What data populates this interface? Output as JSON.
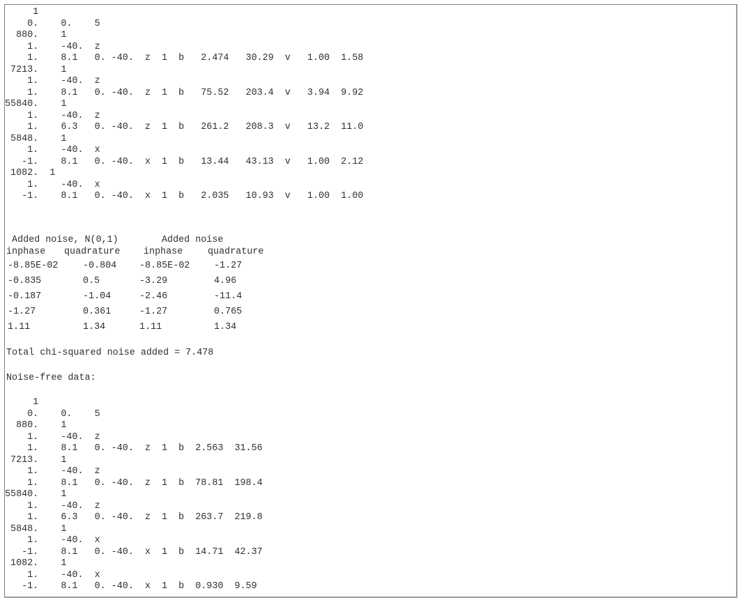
{
  "top_rows": [
    "     1",
    "    0.    0.    5",
    "  880.    1",
    "    1.    -40.  z",
    "    1.    8.1   0. -40.  z  1  b   2.474   30.29  v   1.00  1.58",
    " 7213.    1",
    "    1.    -40.  z",
    "    1.    8.1   0. -40.  z  1  b   75.52   203.4  v   3.94  9.92",
    "55840.    1",
    "    1.    -40.  z",
    "    1.    6.3   0. -40.  z  1  b   261.2   208.3  v   13.2  11.0",
    " 5848.    1",
    "    1.    -40.  x",
    "   -1.    8.1   0. -40.  x  1  b   13.44   43.13  v   1.00  2.12",
    " 1082.  1",
    "    1.    -40.  x",
    "   -1.    8.1   0. -40.  x  1  b   2.035   10.93  v   1.00  1.00"
  ],
  "noise_table": {
    "title_left": " Added noise, N(0,1)",
    "title_right": "Added noise",
    "headers": [
      "inphase",
      "quadrature",
      "inphase",
      "quadrature"
    ],
    "rows": [
      [
        "-8.85E-02",
        "-0.804",
        "-8.85E-02",
        "-1.27"
      ],
      [
        "-0.835",
        "0.5",
        "-3.29",
        "4.96"
      ],
      [
        "-0.187",
        "-1.04",
        "-2.46",
        "-11.4"
      ],
      [
        "-1.27",
        "0.361",
        "-1.27",
        "0.765"
      ],
      [
        "1.11",
        "1.34",
        "1.11",
        "1.34"
      ]
    ]
  },
  "chi_squared_line": "Total chi-squared noise added = 7.478",
  "noise_free_label": "Noise-free data:",
  "bottom_rows": [
    "     1",
    "    0.    0.    5",
    "  880.    1",
    "    1.    -40.  z",
    "    1.    8.1   0. -40.  z  1  b  2.563  31.56",
    " 7213.    1",
    "    1.    -40.  z",
    "    1.    8.1   0. -40.  z  1  b  78.81  198.4",
    "55840.    1",
    "    1.    -40.  z",
    "    1.    6.3   0. -40.  z  1  b  263.7  219.8",
    " 5848.    1",
    "    1.    -40.  x",
    "   -1.    8.1   0. -40.  x  1  b  14.71  42.37",
    " 1082.    1",
    "    1.    -40.  x",
    "   -1.    8.1   0. -40.  x  1  b  0.930  9.59"
  ]
}
